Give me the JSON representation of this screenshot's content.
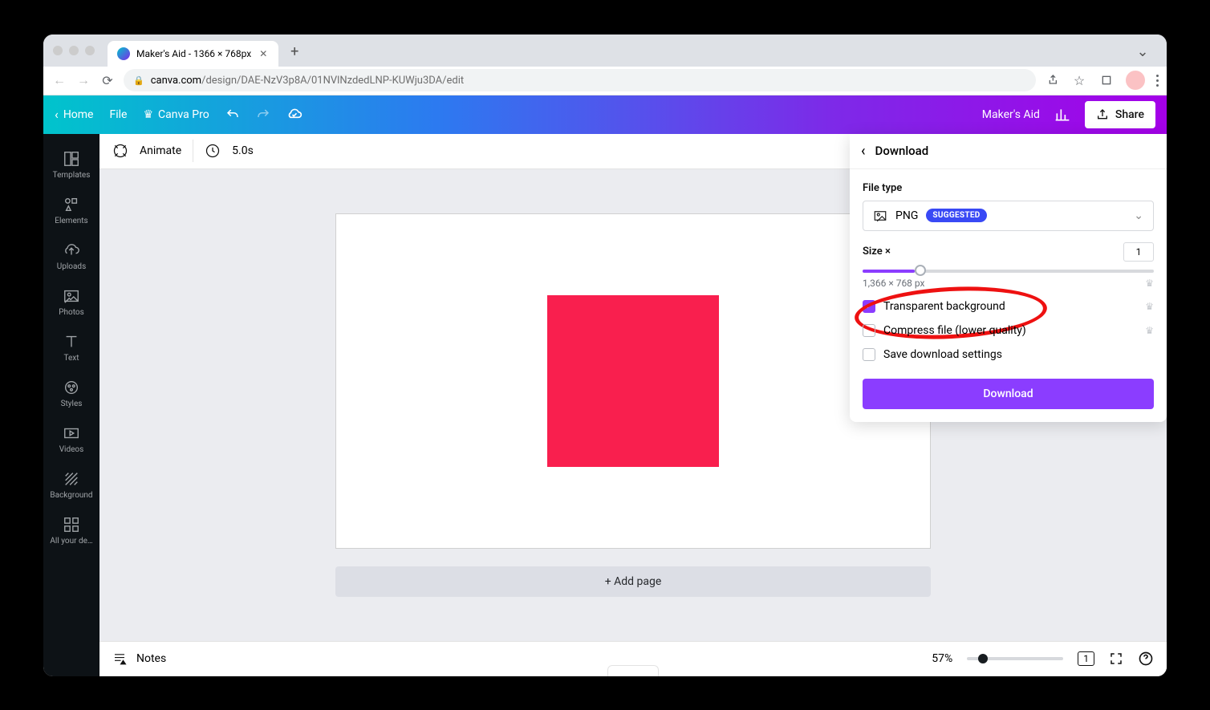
{
  "browser": {
    "tab_title": "Maker's Aid - 1366 × 768px",
    "url_domain": "canva.com",
    "url_path": "/design/DAE-NzV3p8A/01NVlNzdedLNP-KUWju3DA/edit"
  },
  "appbar": {
    "home": "Home",
    "file": "File",
    "canva_pro": "Canva Pro",
    "project_title": "Maker's Aid",
    "share": "Share"
  },
  "rail": {
    "items": [
      "Templates",
      "Elements",
      "Uploads",
      "Photos",
      "Text",
      "Styles",
      "Videos",
      "Background",
      "All your de…"
    ]
  },
  "toolbar2": {
    "animate": "Animate",
    "duration": "5.0s"
  },
  "canvas": {
    "add_page": "+ Add page"
  },
  "footer": {
    "notes": "Notes",
    "zoom": "57%",
    "page_indicator": "1"
  },
  "panel": {
    "title": "Download",
    "file_type_label": "File type",
    "file_type_value": "PNG",
    "file_type_badge": "SUGGESTED",
    "size_label": "Size ×",
    "size_value": "1",
    "dimensions": "1,366 × 768 px",
    "opt_transparent": "Transparent background",
    "opt_compress": "Compress file (lower quality)",
    "opt_save": "Save download settings",
    "download_btn": "Download"
  }
}
